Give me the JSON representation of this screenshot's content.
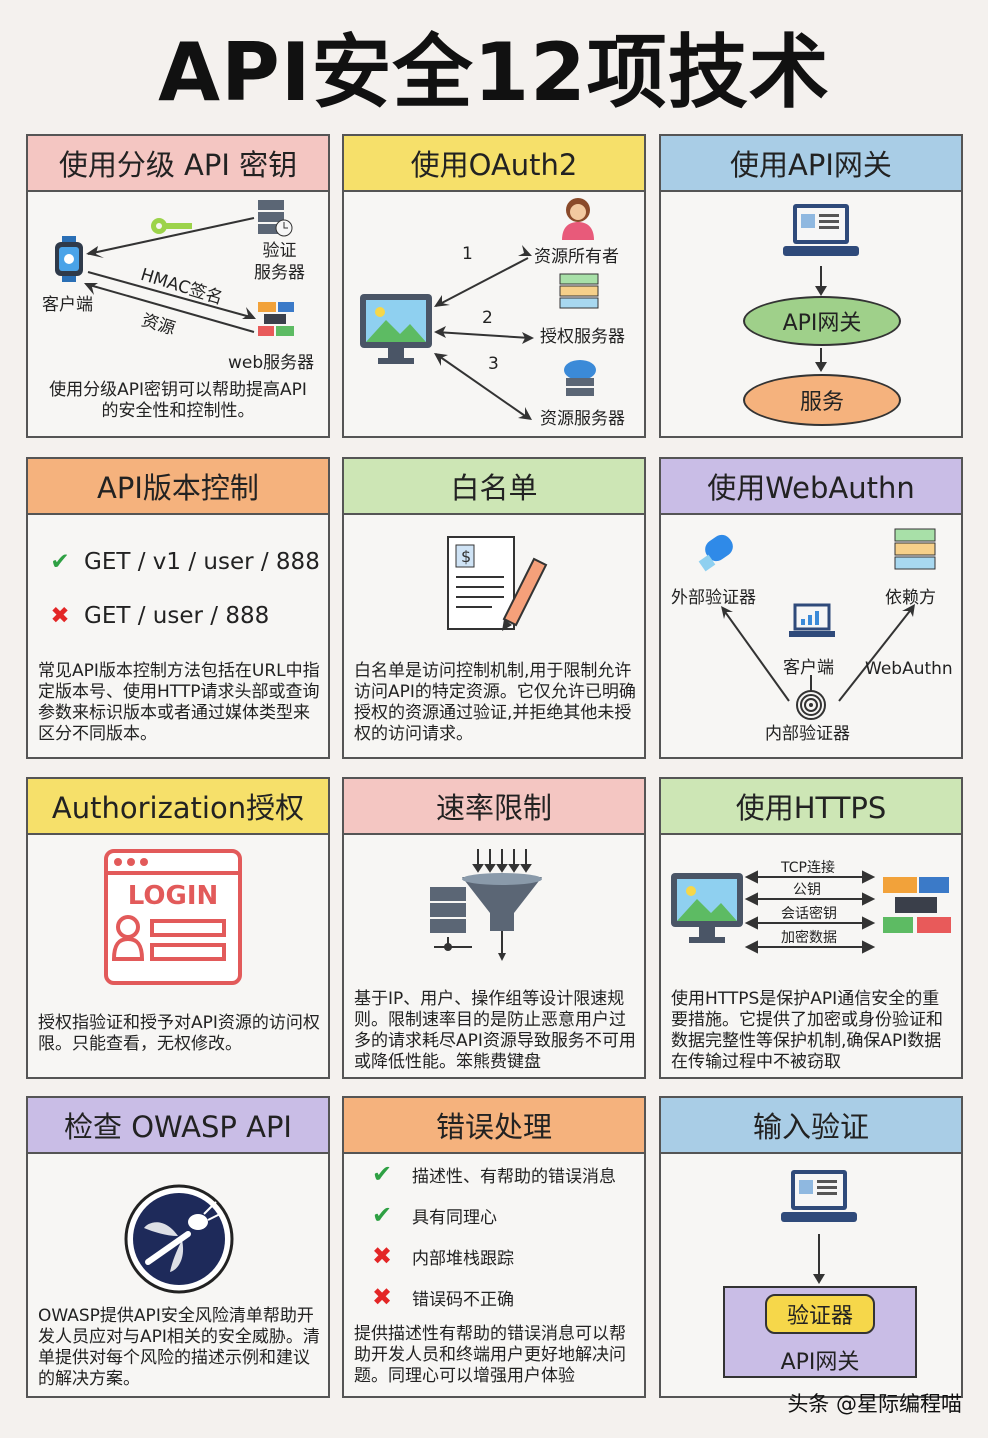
{
  "title": "API安全12项技术",
  "colors": {
    "pink": "#f4c6c2",
    "yellow": "#f6e06a",
    "blue": "#a9cde6",
    "orange": "#f5b27d",
    "green": "#cde6b5",
    "purple": "#c9bde6"
  },
  "cards": {
    "c1": {
      "header": "使用分级 API 密钥",
      "color": "#f4c6c2",
      "client": "客户端",
      "auth_server": "验证\n服务器",
      "hmac": "HMAC签名",
      "resource": "资源",
      "web_server": "web服务器",
      "desc": "使用分级API密钥可以帮助提高API的安全性和控制性。",
      "icons": [
        "smartwatch-icon",
        "key-icon",
        "server-icon",
        "server-stack-icon"
      ]
    },
    "c2": {
      "header": "使用OAuth2",
      "color": "#f6e06a",
      "n1": "1",
      "n2": "2",
      "n3": "3",
      "owner": "资源所有者",
      "auth_server": "授权服务器",
      "res_server": "资源服务器",
      "icons": [
        "monitor-icon",
        "person-icon",
        "server-icon",
        "cloud-server-icon"
      ]
    },
    "c3": {
      "header": "使用API网关",
      "color": "#a9cde6",
      "gateway": "API网关",
      "service": "服务",
      "icons": [
        "laptop-icon"
      ]
    },
    "c4": {
      "header": "API版本控制",
      "color": "#f5b27d",
      "good": "GET / v1 / user / 888",
      "bad": "GET / user / 888",
      "desc": "常见API版本控制方法包括在URL中指定版本号、使用HTTP请求头部或查询参数来标识版本或者通过媒体类型来区分不同版本。"
    },
    "c5": {
      "header": "白名单",
      "color": "#cde6b5",
      "desc": "白名单是访问控制机制,用于限制允许访问API的特定资源。它仅允许已明确授权的资源通过验证,并拒绝其他未授权的访问请求。",
      "icons": [
        "document-pen-icon"
      ]
    },
    "c6": {
      "header": "使用WebAuthn",
      "color": "#c9bde6",
      "external": "外部验证器",
      "relying": "依赖方",
      "client": "客户端",
      "webauthn": "WebAuthn",
      "internal": "内部验证器",
      "icons": [
        "usb-key-icon",
        "server-icon",
        "laptop-chart-icon",
        "fingerprint-icon"
      ]
    },
    "c7": {
      "header": "Authorization授权",
      "color": "#f6e06a",
      "login": "LOGIN",
      "desc": "授权指验证和授予对API资源的访问权限。只能查看，无权修改。",
      "icons": [
        "login-window-icon"
      ]
    },
    "c8": {
      "header": "速率限制",
      "color": "#f4c6c2",
      "desc": "基于IP、用户、操作组等设计限速规则。限制速率目的是防止恶意用户过多的请求耗尽API资源导致服务不可用或降低性能。笨熊费键盘",
      "icons": [
        "funnel-server-icon"
      ]
    },
    "c9": {
      "header": "使用HTTPS",
      "color": "#cde6b5",
      "tcp": "TCP连接",
      "pubkey": "公钥",
      "session": "会话密钥",
      "encrypted": "加密数据",
      "desc": "使用HTTPS是保护API通信安全的重要措施。它提供了加密或身份验证和数据完整性等保护机制,确保API数据在传输过程中不被窃取",
      "icons": [
        "monitor-icon",
        "server-stack-icon"
      ]
    },
    "c10": {
      "header": "检查 OWASP API",
      "color": "#c9bde6",
      "desc": "OWASP提供API安全风险清单帮助开发人员应对与API相关的安全威胁。清单提供对每个风险的描述示例和建议的解决方案。",
      "icons": [
        "owasp-wasp-icon"
      ]
    },
    "c11": {
      "header": "错误处理",
      "color": "#f5b27d",
      "items": [
        "描述性、有帮助的错误消息",
        "具有同理心",
        "内部堆栈跟踪",
        "错误码不正确"
      ],
      "desc": "提供描述性有帮助的错误消息可以帮助开发人员和终端用户更好地解决问题。同理心可以增强用户体验"
    },
    "c12": {
      "header": "输入验证",
      "color": "#a9cde6",
      "validator": "验证器",
      "gateway": "API网关",
      "icons": [
        "laptop-icon"
      ]
    }
  },
  "watermark": "头条 @星际编程喵"
}
